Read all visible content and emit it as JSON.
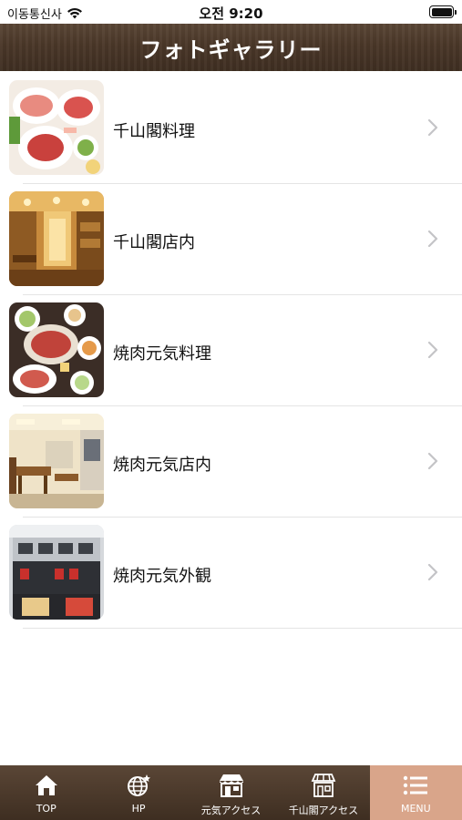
{
  "status_bar": {
    "carrier": "이동통신사",
    "time": "오전 9:20"
  },
  "header": {
    "title": "フォトギャラリー"
  },
  "gallery": {
    "items": [
      {
        "label": "千山閣料理"
      },
      {
        "label": "千山閣店内"
      },
      {
        "label": "焼肉元気料理"
      },
      {
        "label": "焼肉元気店内"
      },
      {
        "label": "焼肉元気外観"
      }
    ]
  },
  "tab_bar": {
    "tabs": [
      {
        "label": "TOP",
        "icon": "home-icon"
      },
      {
        "label": "HP",
        "icon": "globe-icon"
      },
      {
        "label": "元気アクセス",
        "icon": "shop-icon"
      },
      {
        "label": "千山閣アクセス",
        "icon": "shop-icon"
      },
      {
        "label": "MENU",
        "icon": "menu-icon"
      }
    ],
    "active_color": "#d9a58a",
    "bar_color": "#4a3728"
  }
}
